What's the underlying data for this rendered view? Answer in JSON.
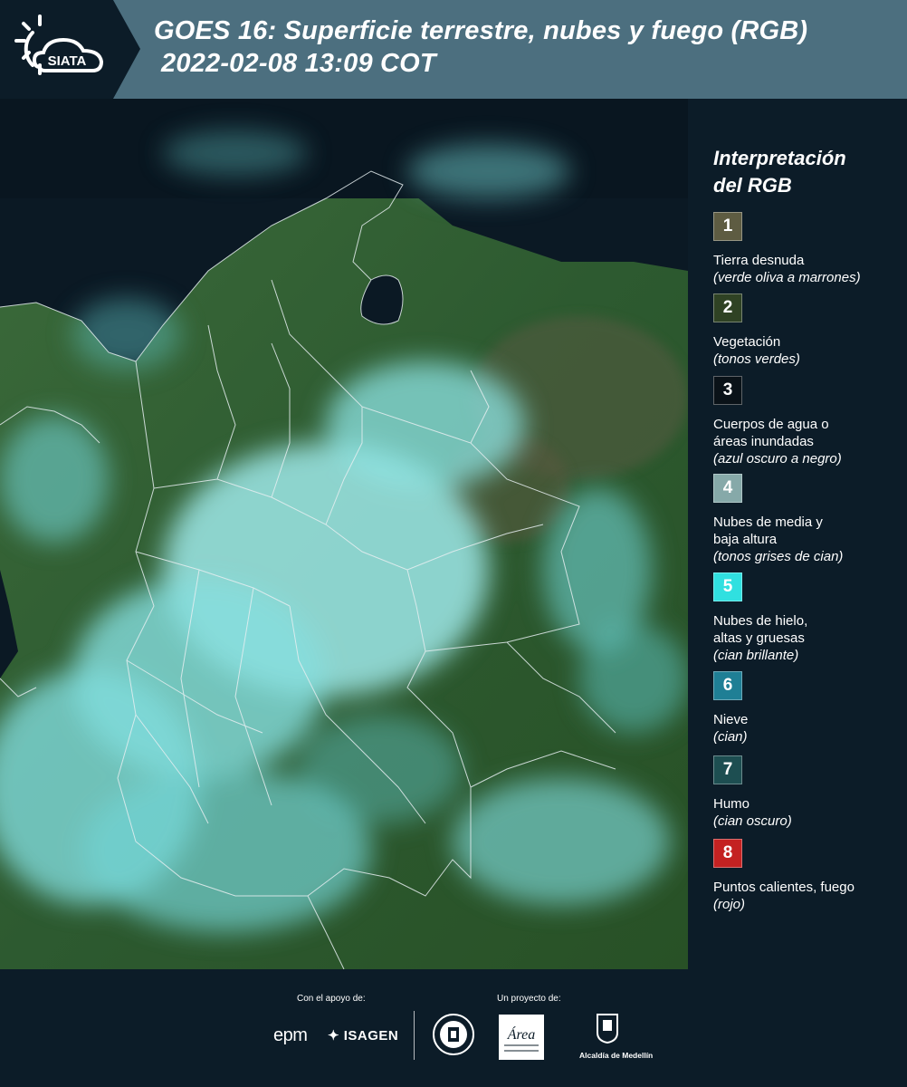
{
  "header": {
    "logo_text": "SIATA",
    "title_line1": "GOES 16: Superficie terrestre, nubes y fuego (RGB)",
    "title_line2": "2022-02-08 13:09 COT"
  },
  "map": {
    "colors": {
      "ocean": "#0b1924",
      "land": "#2f5a33",
      "cloud": "#7fe2e2",
      "border": "#e6eef0"
    }
  },
  "legend": {
    "title_line1": "Interpretación",
    "title_line2": "del RGB",
    "items": [
      {
        "number": "1",
        "color": "#5e5c42",
        "label_lines": [
          "Tierra desnuda"
        ],
        "hint": "(verde oliva a marrones)"
      },
      {
        "number": "2",
        "color": "#2f4224",
        "label_lines": [
          "Vegetación"
        ],
        "hint": "(tonos verdes)"
      },
      {
        "number": "3",
        "color": "#0a1218",
        "label_lines": [
          "Cuerpos de agua o",
          "áreas inundadas"
        ],
        "hint": "(azul oscuro a negro)"
      },
      {
        "number": "4",
        "color": "#86a9a9",
        "label_lines": [
          "Nubes de media y",
          "baja altura"
        ],
        "hint": "(tonos grises de cian)"
      },
      {
        "number": "5",
        "color": "#30e0e0",
        "label_lines": [
          "Nubes de hielo,",
          "altas y gruesas"
        ],
        "hint": "(cian brillante)"
      },
      {
        "number": "6",
        "color": "#1f7f95",
        "label_lines": [
          "Nieve"
        ],
        "hint": "(cian)"
      },
      {
        "number": "7",
        "color": "#1d4e51",
        "label_lines": [
          "Humo"
        ],
        "hint": "(cian oscuro)"
      },
      {
        "number": "8",
        "color": "#c42222",
        "label_lines": [
          "Puntos calientes, fuego"
        ],
        "hint": "(rojo)"
      }
    ]
  },
  "footer": {
    "support_label": "Con el apoyo de:",
    "project_label": "Un proyecto de:",
    "sponsor_epm": "epm",
    "sponsor_isagen": "ISAGEN",
    "area_logo_text": "Área",
    "medellin_label": "Alcaldía de Medellín"
  }
}
